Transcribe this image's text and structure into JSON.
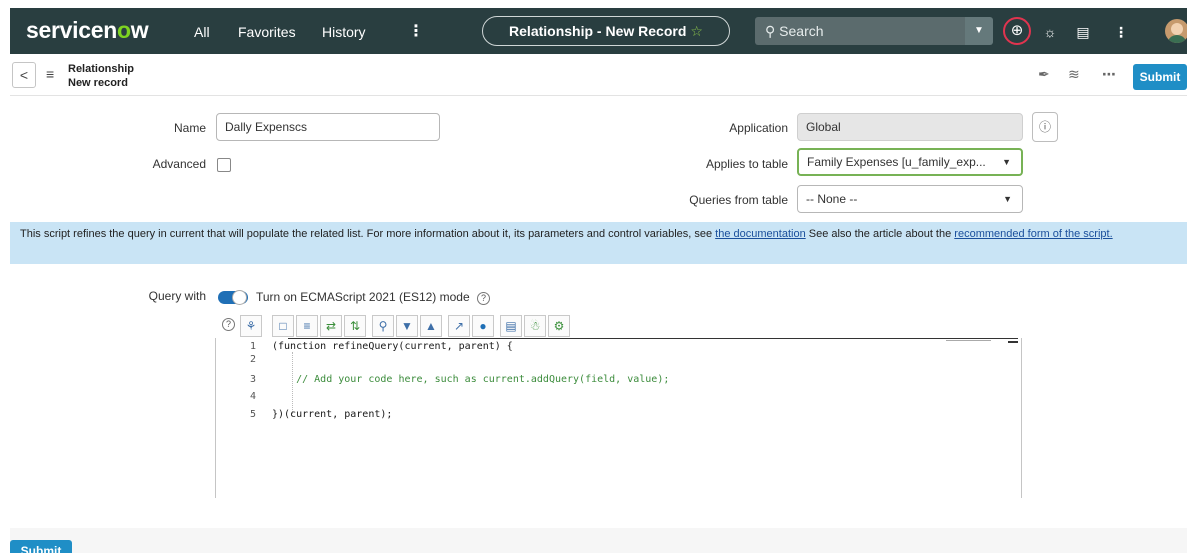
{
  "header": {
    "logo_text_a": "servicen",
    "logo_text_o": "o",
    "logo_text_b": "w",
    "nav": [
      "All",
      "Favorites",
      "History"
    ],
    "more": "⋮",
    "record_title": "Relationship - New Record",
    "star": "☆",
    "search_placeholder": "Search",
    "icons": [
      "globe-icon",
      "chat-icon",
      "inbox-icon",
      "more-icon",
      "avatar"
    ]
  },
  "formbar": {
    "back": "<",
    "title": "Relationship",
    "subtitle": "New record",
    "submit_label": "Submit"
  },
  "fields": {
    "name_label": "Name",
    "name_value": "Dally Expenscs",
    "advanced_label": "Advanced",
    "application_label": "Application",
    "application_value": "Global",
    "applies_label": "Applies to table",
    "applies_value": "Family Expenses [u_family_exp...",
    "queries_label": "Queries from table",
    "queries_value": "-- None --"
  },
  "banner": {
    "text1": "This script refines the query in current that will populate the related list. For more information about it, its parameters and control variables, see ",
    "link1": "the documentation",
    "text2": " See also the article about the ",
    "link2": "recommended form of the script."
  },
  "query": {
    "label": "Query with",
    "toggle_text": "Turn on ECMAScript 2021 (ES12) mode",
    "help": "?"
  },
  "editor": {
    "lines": [
      {
        "n": "1",
        "code": "(function refineQuery(current, parent) {",
        "comment": ""
      },
      {
        "n": "2",
        "code": "",
        "comment": ""
      },
      {
        "n": "3",
        "code": "    ",
        "comment": "// Add your code here, such as current.addQuery(field, value);"
      },
      {
        "n": "4",
        "code": "",
        "comment": ""
      },
      {
        "n": "5",
        "code": "})(current, parent);",
        "comment": ""
      }
    ]
  },
  "bottom": {
    "submit_label": "Submit"
  },
  "colors": {
    "header_bg": "#293e40",
    "accent": "#1f8ec6",
    "banner_bg": "#c9e4f5",
    "focus_border": "#77b255"
  }
}
